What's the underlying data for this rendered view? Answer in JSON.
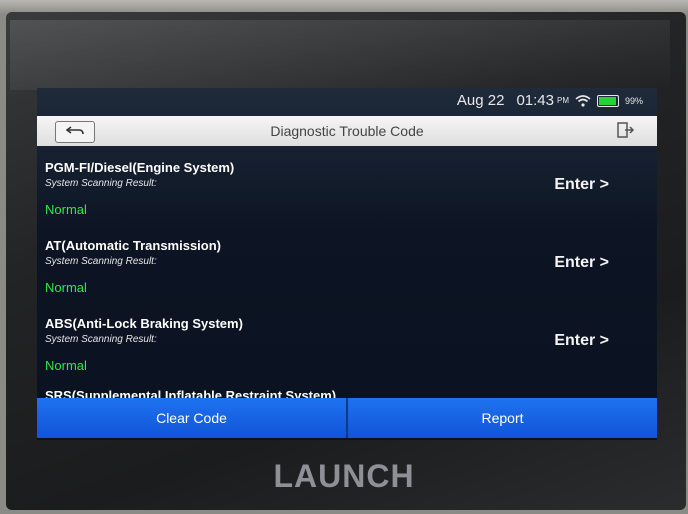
{
  "status_bar": {
    "date": "Aug 22",
    "time": "01:43",
    "ampm": "PM",
    "battery_percent": "99%",
    "battery_level": 0.99,
    "wifi_icon": "wifi-icon",
    "battery_icon": "battery-icon"
  },
  "header": {
    "title": "Diagnostic Trouble Code",
    "back_icon": "back-arrow-icon",
    "exit_icon": "exit-icon"
  },
  "systems": [
    {
      "name": "PGM-FI/Diesel(Engine System)",
      "scan_label": "System Scanning Result:",
      "result": "Normal",
      "action": "Enter >"
    },
    {
      "name": "AT(Automatic Transmission)",
      "scan_label": "System Scanning Result:",
      "result": "Normal",
      "action": "Enter >"
    },
    {
      "name": "ABS(Anti-Lock Braking System)",
      "scan_label": "System Scanning Result:",
      "result": "Normal",
      "action": "Enter >"
    }
  ],
  "partial_item": "SRS(Supplemental Inflatable Restraint System)",
  "footer": {
    "clear_code": "Clear Code",
    "report": "Report"
  },
  "device": {
    "brand": "LAUNCH"
  },
  "colors": {
    "accent_blue": "#1565e8",
    "status_green": "#2ee84a"
  }
}
